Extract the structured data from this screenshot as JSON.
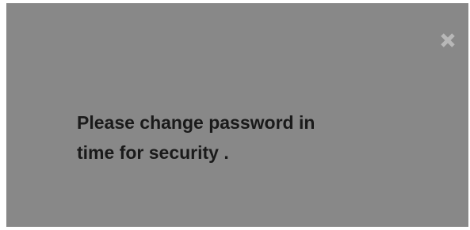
{
  "dialog": {
    "close_icon": "close-icon",
    "message_lines": [
      "Please change password in",
      "time for security ."
    ]
  },
  "colors": {
    "dialog_background": "#888888",
    "close_icon": "#b8b8b8",
    "message_text": "#1a1a1a"
  }
}
